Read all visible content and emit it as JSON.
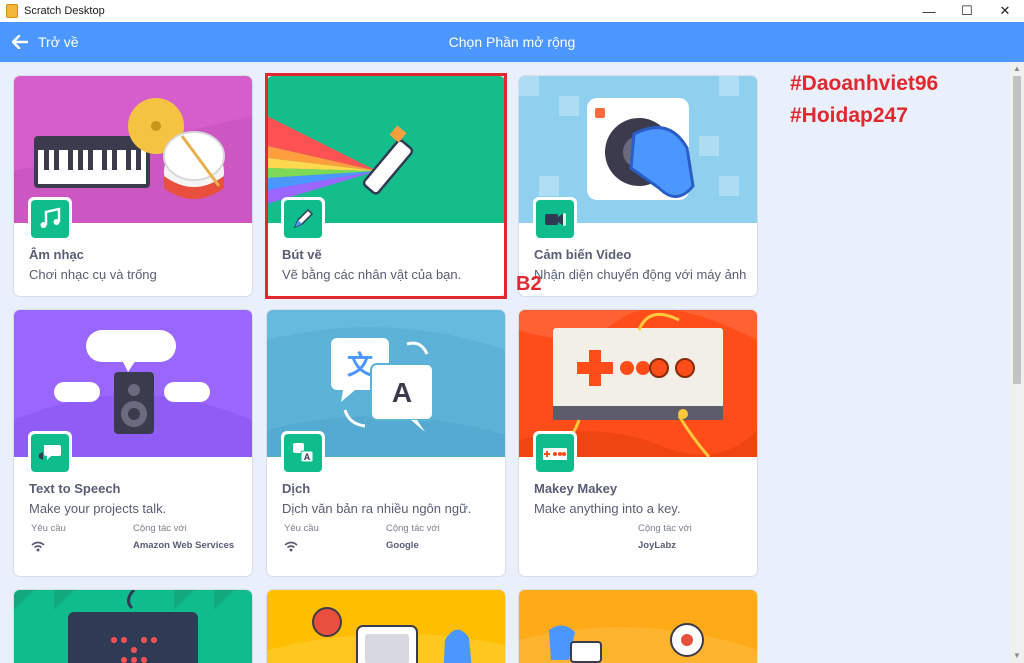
{
  "window": {
    "title": "Scratch Desktop",
    "controls": {
      "minimize": "—",
      "maximize": "☐",
      "close": "✕"
    }
  },
  "header": {
    "back_label": "Trở về",
    "title": "Chọn Phần mở rộng"
  },
  "annotations": {
    "step_label": "B2",
    "watermark_line1": "#Daoanhviet96",
    "watermark_line2": "#Hoidap247"
  },
  "extensions": [
    {
      "name": "Âm nhạc",
      "description": "Chơi nhạc cụ và trống",
      "image_color": "#d65ecb"
    },
    {
      "name": "Bút vẽ",
      "description": "Vẽ bằng các nhân vật của bạn.",
      "image_color": "#15bd8b"
    },
    {
      "name": "Cảm biến Video",
      "description": "Nhận diện chuyển động với máy ảnh",
      "image_color": "#8fd0ee"
    },
    {
      "name": "Text to Speech",
      "description": "Make your projects talk.",
      "requires_label": "Yêu cầu",
      "collab_label": "Cộng tác với",
      "collaborator": "Amazon Web Services",
      "image_color": "#9966ff"
    },
    {
      "name": "Dịch",
      "description": "Dịch văn bản ra nhiều ngôn ngữ.",
      "requires_label": "Yêu cầu",
      "collab_label": "Cộng tác với",
      "collaborator": "Google",
      "image_color": "#5cb1d6"
    },
    {
      "name": "Makey Makey",
      "description": "Make anything into a key.",
      "collab_label": "Cộng tác với",
      "collaborator": "JoyLabz",
      "image_color": "#ff4d1a"
    }
  ],
  "colors": {
    "header_bg": "#4c97ff",
    "highlight": "#e0282e",
    "extension_icon_bg": "#0fbd8c",
    "text": "#575e75"
  }
}
